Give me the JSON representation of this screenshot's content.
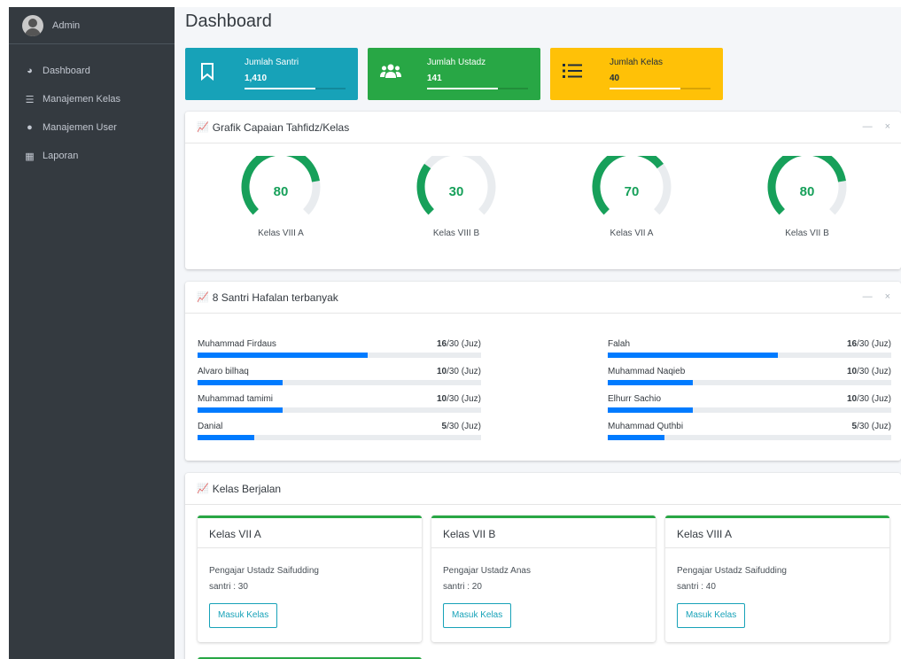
{
  "sidebar": {
    "user": "Admin",
    "items": [
      {
        "label": "Dashboard",
        "icon": "tachometer-icon"
      },
      {
        "label": "Manajemen Kelas",
        "icon": "list-icon"
      },
      {
        "label": "Manajemen User",
        "icon": "users-icon"
      },
      {
        "label": "Laporan",
        "icon": "table-icon"
      }
    ]
  },
  "page": {
    "title": "Dashboard"
  },
  "info_boxes": [
    {
      "label": "Jumlah Santri",
      "value": "1,410",
      "color": "#17a2b8",
      "icon": "bookmark-icon"
    },
    {
      "label": "Jumlah Ustadz",
      "value": "141",
      "color": "#28a745",
      "icon": "users-icon"
    },
    {
      "label": "Jumlah Kelas",
      "value": "40",
      "color": "#ffc107",
      "icon": "list-icon"
    }
  ],
  "tahfidz_card": {
    "title": "Grafik Capaian Tahfidz/Kelas",
    "gauges": [
      {
        "value": "80",
        "label": "Kelas VIII A"
      },
      {
        "value": "30",
        "label": "Kelas VIII B"
      },
      {
        "value": "70",
        "label": "Kelas VII A"
      },
      {
        "value": "80",
        "label": "Kelas VII B"
      }
    ]
  },
  "hafalan_card": {
    "title": "8 Santri Hafalan terbanyak",
    "suffix": "/30 (Juz)",
    "students": [
      {
        "name": "Muhammad Firdaus",
        "juz": "16",
        "fraction": 0.6
      },
      {
        "name": "Alvaro bilhaq",
        "juz": "10",
        "fraction": 0.3
      },
      {
        "name": "Muhammad tamimi",
        "juz": "10",
        "fraction": 0.3
      },
      {
        "name": "Danial",
        "juz": "5",
        "fraction": 0.2
      },
      {
        "name": "Falah",
        "juz": "16",
        "fraction": 0.6
      },
      {
        "name": "Muhammad Naqieb",
        "juz": "10",
        "fraction": 0.3
      },
      {
        "name": "Elhurr Sachio",
        "juz": "10",
        "fraction": 0.3
      },
      {
        "name": "Muhammad Quthbi",
        "juz": "5",
        "fraction": 0.2
      }
    ]
  },
  "kelas_card": {
    "title": "Kelas Berjalan",
    "button_label": "Masuk Kelas",
    "classes": [
      {
        "name": "Kelas VII A",
        "teacher": "Pengajar Ustadz Saifudding",
        "santri": "santri : 30"
      },
      {
        "name": "Kelas VII B",
        "teacher": "Pengajar Ustadz Anas",
        "santri": "santri : 20"
      },
      {
        "name": "Kelas VIII A",
        "teacher": "Pengajar Ustadz Saifudding",
        "santri": "santri : 40"
      }
    ]
  },
  "colors": {
    "gauge": "#17a05a",
    "gauge_track": "#e9ecef",
    "progress": "#007bff",
    "sidebar": "#343a40"
  }
}
